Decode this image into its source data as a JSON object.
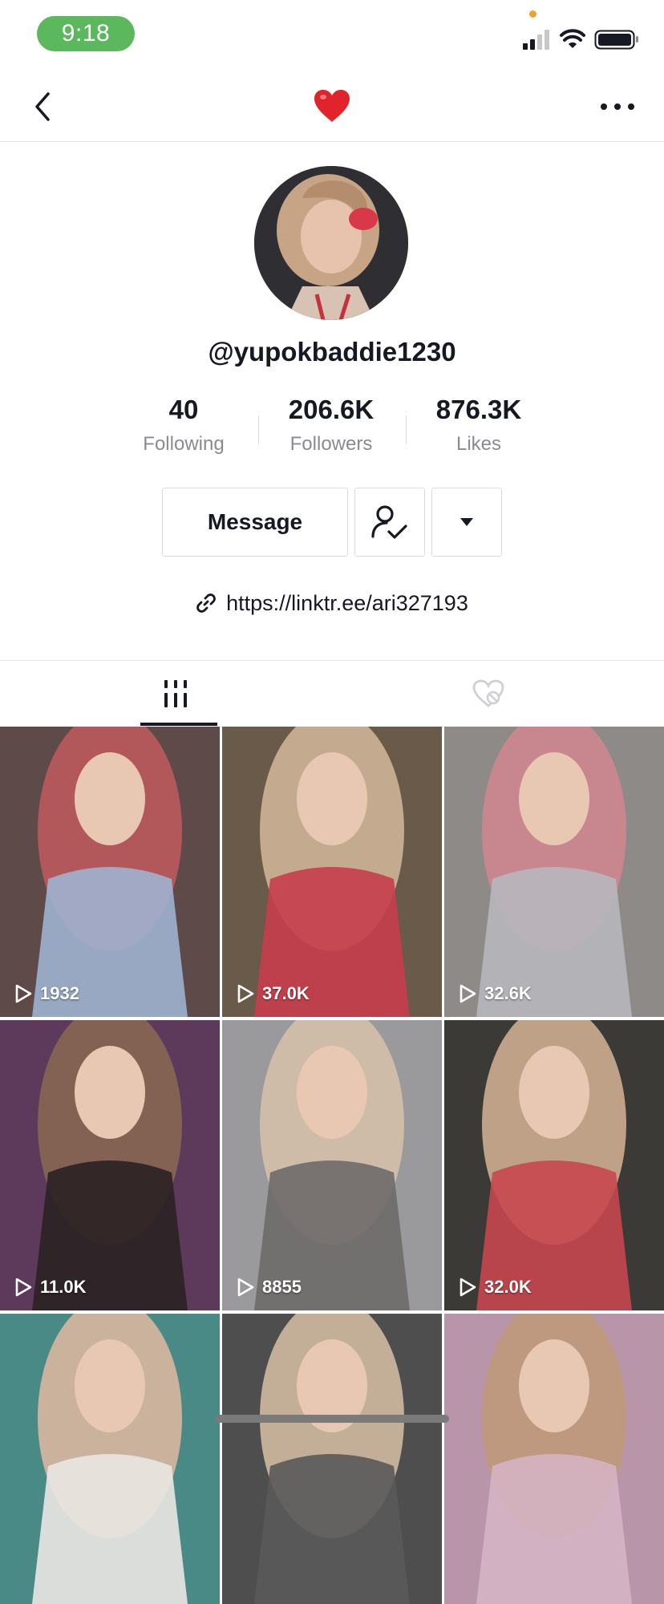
{
  "status_bar": {
    "time": "9:18"
  },
  "nav": {
    "title_icon": "heart-emoji",
    "back_icon": "chevron-left-icon",
    "more_icon": "ellipsis-icon"
  },
  "profile": {
    "username": "@yupokbaddie1230",
    "stats": [
      {
        "value": "40",
        "label": "Following"
      },
      {
        "value": "206.6K",
        "label": "Followers"
      },
      {
        "value": "876.3K",
        "label": "Likes"
      }
    ],
    "message_label": "Message",
    "link": "https://linktr.ee/ari327193"
  },
  "tabs": [
    {
      "name": "videos",
      "icon": "grid-icon",
      "active": true
    },
    {
      "name": "liked",
      "icon": "hidden-heart-icon",
      "active": false
    }
  ],
  "videos": [
    {
      "views": "1932",
      "colors": [
        "#5e4a48",
        "#c25a5e",
        "#9fb3d0"
      ]
    },
    {
      "views": "37.0K",
      "colors": [
        "#6a5a4a",
        "#d4b89a",
        "#c73d4c"
      ]
    },
    {
      "views": "32.6K",
      "colors": [
        "#8e8a88",
        "#d28590",
        "#b7b7bd"
      ]
    },
    {
      "views": "11.0K",
      "colors": [
        "#5d3a5c",
        "#8a6a52",
        "#2a2222"
      ]
    },
    {
      "views": "8855",
      "colors": [
        "#9a9a9c",
        "#d8c2aa",
        "#6e6a6a"
      ]
    },
    {
      "views": "32.0K",
      "colors": [
        "#3b3a36",
        "#d7b496",
        "#c7474f"
      ]
    },
    {
      "views": "",
      "colors": [
        "#4a8a86",
        "#e0b8a0",
        "#eae6e2"
      ]
    },
    {
      "views": "",
      "colors": [
        "#4e4e4e",
        "#d8c0a4",
        "#5a5a5a"
      ]
    },
    {
      "views": "",
      "colors": [
        "#b995aa",
        "#c09a78",
        "#d4b4c4"
      ]
    }
  ],
  "colors": {
    "text": "#161823",
    "secondary": "#8a8b91",
    "border": "#dcdcdc",
    "time_pill": "#5cb85c"
  }
}
